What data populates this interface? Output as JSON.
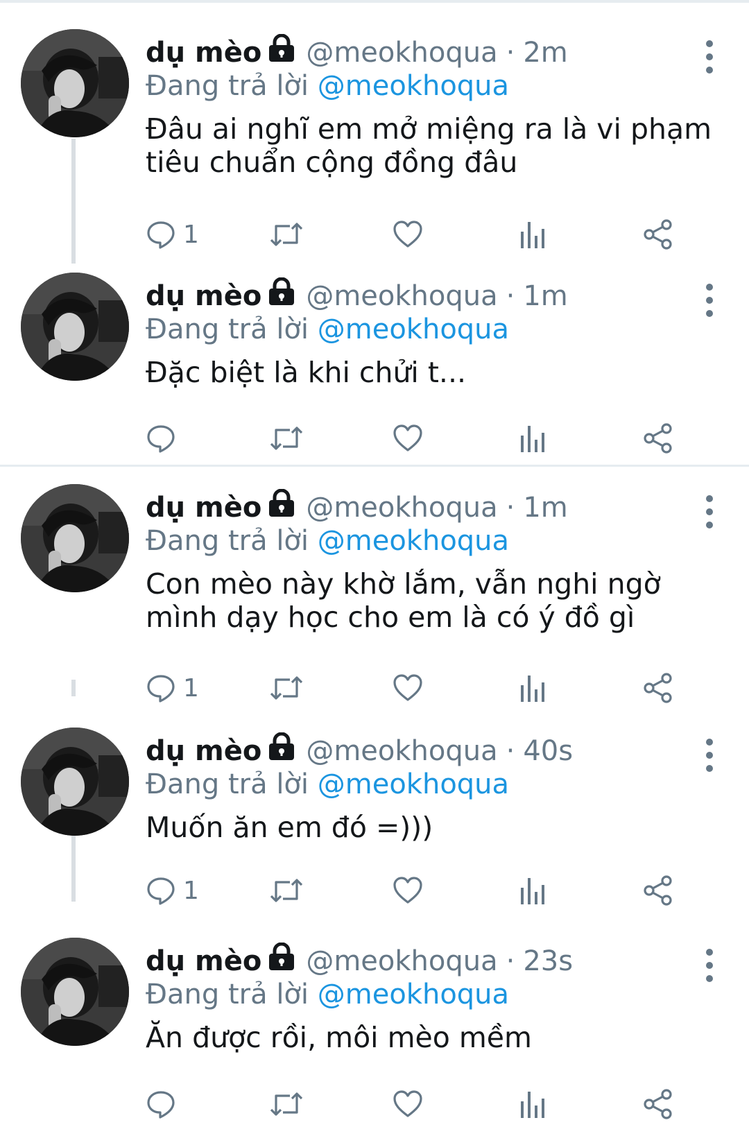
{
  "tweets": [
    {
      "name": "dụ mèo",
      "handle": "@meokhoqua",
      "separator": "·",
      "time": "2m",
      "reply_prefix": "Đang trả lời",
      "reply_to": "@meokhoqua",
      "text": "Đâu ai nghĩ em mở miệng ra là vi phạm tiêu chuẩn cộng đồng đâu",
      "reply_count": "1"
    },
    {
      "name": "dụ mèo",
      "handle": "@meokhoqua",
      "separator": "·",
      "time": "1m",
      "reply_prefix": "Đang trả lời",
      "reply_to": "@meokhoqua",
      "text": "Đặc biệt là khi chửi t...",
      "reply_count": ""
    },
    {
      "name": "dụ mèo",
      "handle": "@meokhoqua",
      "separator": "·",
      "time": "1m",
      "reply_prefix": "Đang trả lời",
      "reply_to": "@meokhoqua",
      "text": "Con mèo này khờ lắm, vẫn nghi ngờ mình dạy học cho em là có ý đồ gì",
      "reply_count": "1"
    },
    {
      "name": "dụ mèo",
      "handle": "@meokhoqua",
      "separator": "·",
      "time": "40s",
      "reply_prefix": "Đang trả lời",
      "reply_to": "@meokhoqua",
      "text": "Muốn ăn em đó =)))",
      "reply_count": "1"
    },
    {
      "name": "dụ mèo",
      "handle": "@meokhoqua",
      "separator": "·",
      "time": "23s",
      "reply_prefix": "Đang trả lời",
      "reply_to": "@meokhoqua",
      "text": "Ăn được rồi, môi mèo mềm",
      "reply_count": ""
    }
  ],
  "icons": {
    "lock": "lock-icon",
    "more": "more-vertical-icon",
    "reply": "comment-icon",
    "retweet": "retweet-icon",
    "like": "heart-icon",
    "stats": "bar-chart-icon",
    "share": "share-icon"
  },
  "colors": {
    "text": "#14171a",
    "secondary": "#657786",
    "mention": "#1b95e0",
    "divider": "#e6ecf0",
    "thread_line": "#d9dee2"
  }
}
